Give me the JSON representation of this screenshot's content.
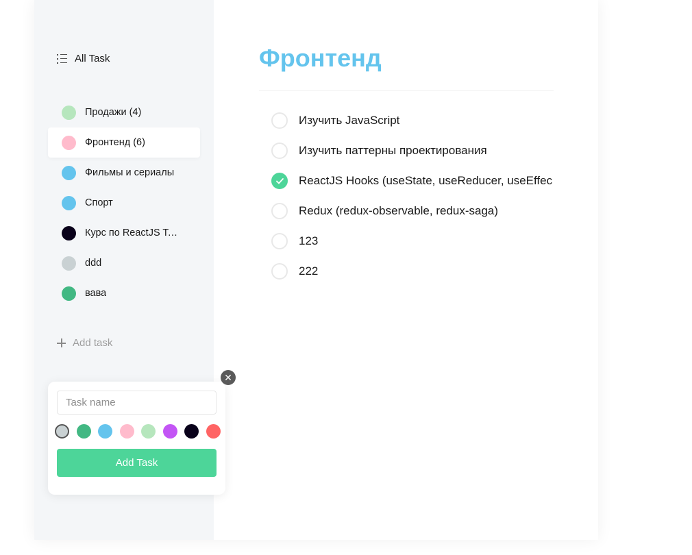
{
  "sidebar": {
    "all_tasks_label": "All Task",
    "folders": [
      {
        "label": "Продажи (4)",
        "color": "#b6e6bd"
      },
      {
        "label": "Фронтенд (6)",
        "color": "#ffbbcc"
      },
      {
        "label": "Фильмы и сериалы",
        "color": "#64c4ed"
      },
      {
        "label": "Спорт",
        "color": "#64c4ed"
      },
      {
        "label": "Курс по ReactJS ToDo",
        "color": "#09011a"
      },
      {
        "label": "ddd",
        "color": "#c9d1d3"
      },
      {
        "label": "вава",
        "color": "#42b883"
      }
    ],
    "active_index": 1,
    "add_task_label": "Add task"
  },
  "popup": {
    "input_placeholder": "Task name",
    "input_value": "",
    "colors": [
      "#c9d1d3",
      "#42b883",
      "#64c4ed",
      "#ffbbcc",
      "#b6e6bd",
      "#c355f5",
      "#09011a",
      "#ff6464"
    ],
    "selected_color_index": 0,
    "add_button_label": "Add Task",
    "close_icon": "close-icon"
  },
  "main": {
    "title": "Фронтенд",
    "title_color": "#64c4ed",
    "tasks": [
      {
        "text": "Изучить JavaScript",
        "completed": false
      },
      {
        "text": "Изучить паттерны проектирования",
        "completed": false
      },
      {
        "text": "ReactJS Hooks (useState, useReducer, useEffec",
        "completed": true
      },
      {
        "text": "Redux (redux-observable, redux-saga)",
        "completed": false
      },
      {
        "text": "123",
        "completed": false
      },
      {
        "text": "222",
        "completed": false
      }
    ]
  }
}
